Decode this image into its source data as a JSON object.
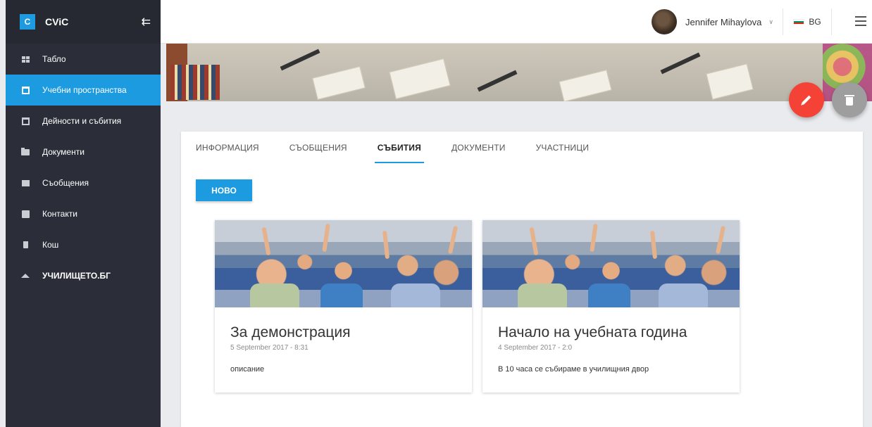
{
  "sidebar": {
    "brand_letter": "C",
    "brand_name": "CViC",
    "collapse_icon": "arrow-collapse-icon",
    "items": [
      {
        "label": "Табло",
        "icon": "dashboard-icon"
      },
      {
        "label": "Учебни пространства",
        "icon": "building-icon"
      },
      {
        "label": "Дейности и събития",
        "icon": "calendar-icon"
      },
      {
        "label": "Документи",
        "icon": "folder-icon"
      },
      {
        "label": "Съобщения",
        "icon": "mail-icon"
      },
      {
        "label": "Контакти",
        "icon": "contact-card-icon"
      },
      {
        "label": "Кош",
        "icon": "trash-icon"
      },
      {
        "label": "УЧИЛИЩЕТО.БГ",
        "icon": "graduation-cap-icon"
      }
    ],
    "active_index": 1
  },
  "topbar": {
    "user_name": "Jennifer Mihaylova",
    "language": "BG"
  },
  "tabs": [
    "ИНФОРМАЦИЯ",
    "СЪОБЩЕНИЯ",
    "СЪБИТИЯ",
    "ДОКУМЕНТИ",
    "УЧАСТНИЦИ"
  ],
  "active_tab": "СЪБИТИЯ",
  "new_button": "НОВО",
  "events": [
    {
      "title": "За демонстрация",
      "date": "5 September 2017 - 8:31",
      "description": "описание"
    },
    {
      "title": "Начало на учебната година",
      "date": "4 September 2017 - 2:0",
      "description": "В 10 часа се събираме в училищния двор"
    }
  ],
  "colors": {
    "accent": "#1c9be1",
    "sidebar_bg": "#2b2e38",
    "edit_fab": "#f44336",
    "delete_fab": "#9e9e9e"
  }
}
